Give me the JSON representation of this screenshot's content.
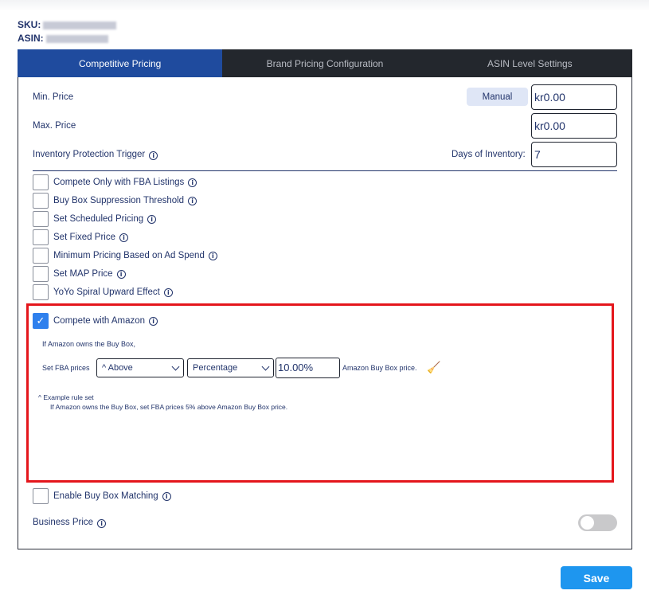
{
  "header": {
    "sku_label": "SKU:",
    "asin_label": "ASIN:"
  },
  "tabs": [
    {
      "label": "Competitive Pricing",
      "active": true
    },
    {
      "label": "Brand Pricing Configuration",
      "active": false
    },
    {
      "label": "ASIN Level Settings",
      "active": false
    }
  ],
  "pricing": {
    "min_price_label": "Min. Price",
    "manual_label": "Manual",
    "min_price_value": "kr0.00",
    "max_price_label": "Max. Price",
    "max_price_value": "kr0.00",
    "inventory_label": "Inventory Protection Trigger",
    "days_label": "Days of Inventory:",
    "days_value": "7"
  },
  "options": [
    {
      "label": "Compete Only with FBA Listings",
      "checked": false
    },
    {
      "label": "Buy Box Suppression Threshold",
      "checked": false
    },
    {
      "label": "Set Scheduled Pricing",
      "checked": false
    },
    {
      "label": "Set Fixed Price",
      "checked": false
    },
    {
      "label": "Minimum Pricing Based on Ad Spend",
      "checked": false
    },
    {
      "label": "Set MAP Price",
      "checked": false
    },
    {
      "label": "YoYo Spiral Upward Effect",
      "checked": false
    }
  ],
  "amazon": {
    "label": "Compete with Amazon",
    "checked": true,
    "intro": "If Amazon owns the Buy Box,",
    "set_prefix": "Set FBA prices",
    "direction_value": "^ Above",
    "mode_value": "Percentage",
    "amount_value": "10.00%",
    "suffix": "Amazon Buy Box price.",
    "example_toggle": "^ Example rule set",
    "example_text": "If Amazon owns the Buy Box, set FBA prices 5% above Amazon Buy Box price."
  },
  "buybox_matching": {
    "label": "Enable Buy Box Matching",
    "checked": false
  },
  "business_price": {
    "label": "Business Price",
    "enabled": false
  },
  "save_label": "Save",
  "colors": {
    "accent": "#1f4b9e",
    "save": "#1e96ef",
    "highlight": "#e4161c",
    "checkbox": "#2f80ed"
  }
}
